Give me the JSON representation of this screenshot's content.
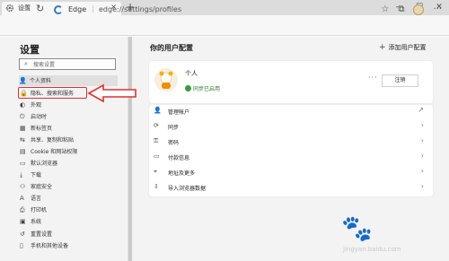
{
  "browser": {
    "tab_title": "设置",
    "tab_close": "×",
    "new_tab": "+",
    "window_controls": [
      "—",
      "☐",
      "✕"
    ],
    "brand": "Edge",
    "separator": "|",
    "url": "edge://settings/profiles",
    "toolbar_icons": [
      "favorites-star-icon",
      "collections-icon",
      "profile-avatar-icon",
      "more-icon"
    ]
  },
  "sidebar": {
    "title": "设置",
    "search_placeholder": "搜索设置",
    "items": [
      {
        "label": "个人资料",
        "icon": "person-icon"
      },
      {
        "label": "隐私、搜索和服务",
        "icon": "lock-icon"
      },
      {
        "label": "外观",
        "icon": "appearance-icon"
      },
      {
        "label": "启动时",
        "icon": "power-icon"
      },
      {
        "label": "新标签页",
        "icon": "newtab-icon"
      },
      {
        "label": "共享、复制和粘贴",
        "icon": "share-icon"
      },
      {
        "label": "Cookie 和网站权限",
        "icon": "cookie-icon"
      },
      {
        "label": "默认浏览器",
        "icon": "browser-icon"
      },
      {
        "label": "下载",
        "icon": "download-icon"
      },
      {
        "label": "家庭安全",
        "icon": "family-icon"
      },
      {
        "label": "语言",
        "icon": "language-icon"
      },
      {
        "label": "打印机",
        "icon": "printer-icon"
      },
      {
        "label": "系统",
        "icon": "system-icon"
      },
      {
        "label": "重置设置",
        "icon": "reset-icon"
      },
      {
        "label": "手机和其他设备",
        "icon": "phone-icon"
      }
    ]
  },
  "main": {
    "title": "你的用户配置",
    "add_profile": "添加用户配置",
    "profile": {
      "name": "个人",
      "sync_status": "同步已启用",
      "more": "···",
      "logout": "注销"
    },
    "rows": [
      {
        "label": "管理帐户",
        "icon": "person-icon",
        "trail": "↗"
      },
      {
        "label": "同步",
        "icon": "sync-icon",
        "trail": "›"
      },
      {
        "label": "密码",
        "icon": "key-icon",
        "trail": "›"
      },
      {
        "label": "付款信息",
        "icon": "card-icon",
        "trail": "›"
      },
      {
        "label": "地址及更多",
        "icon": "location-icon",
        "trail": "›"
      },
      {
        "label": "导入浏览器数据",
        "icon": "import-icon",
        "trail": "›"
      }
    ]
  },
  "annotation": {
    "box_color": "#e03030"
  },
  "watermark": {
    "site": "jingyan.baidu.com"
  }
}
